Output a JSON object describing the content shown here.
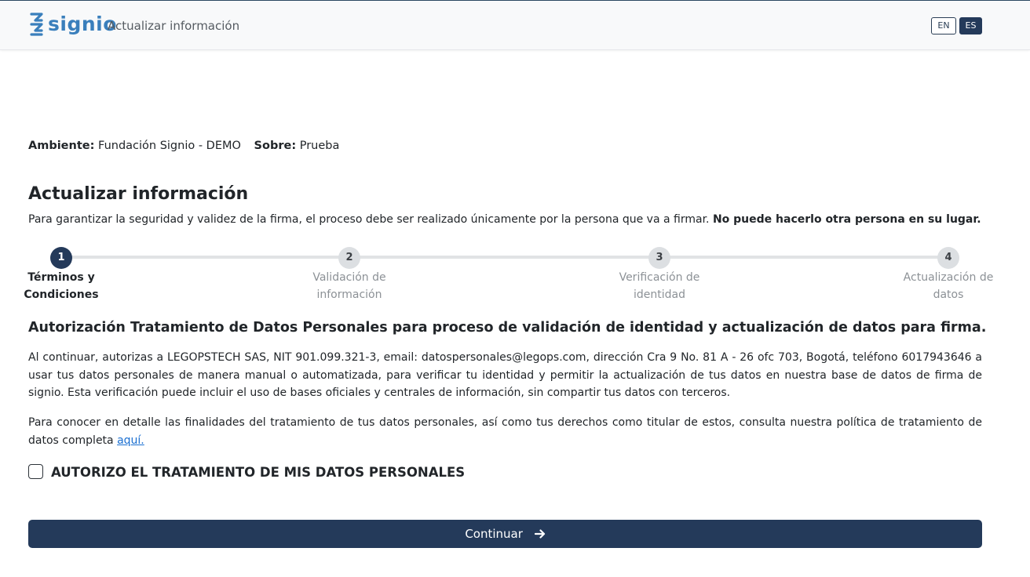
{
  "header": {
    "brand": "signio",
    "title": "Actualizar información",
    "lang_en": "EN",
    "lang_es": "ES",
    "active_lang": "ES",
    "brand_color": "#3a7fbc"
  },
  "env": {
    "ambiente_label": "Ambiente:",
    "ambiente_value": "Fundación Signio - DEMO",
    "sobre_label": "Sobre:",
    "sobre_value": "Prueba"
  },
  "page": {
    "title": "Actualizar información",
    "intro_text": "Para garantizar la seguridad y validez de la firma, el proceso debe ser realizado únicamente por la persona que va a firmar.",
    "intro_bold": "No puede hacerlo otra persona en su lugar."
  },
  "stepper": {
    "current_step": 1,
    "steps": [
      {
        "number": "1",
        "line1": "Términos y",
        "line2": "Condiciones"
      },
      {
        "number": "2",
        "line1": "Validación de",
        "line2": "información"
      },
      {
        "number": "3",
        "line1": "Verificación de",
        "line2": "identidad"
      },
      {
        "number": "4",
        "line1": "Actualización de",
        "line2": "datos"
      }
    ]
  },
  "consent": {
    "title": "Autorización Tratamiento de Datos Personales para proceso de validación de identidad y actualización de datos para firma.",
    "paragraph1": "Al continuar, autorizas a LEGOPSTECH SAS, NIT 901.099.321-3, email: datospersonales@legops.com, dirección Cra 9 No. 81 A - 26 ofc 703, Bogotá, teléfono 6017943646 a usar tus datos personales de manera manual o automatizada, para verificar tu identidad y permitir la actualización de tus datos en nuestra base de datos de firma de signio. Esta verificación puede incluir el uso de bases oficiales y centrales de información, sin compartir tus datos con terceros.",
    "paragraph2": "Para conocer en detalle las finalidades del tratamiento de tus datos personales, así como tus derechos como titular de estos, consulta nuestra política de tratamiento de datos completa",
    "link_text": "aquí.",
    "checkbox_label": "AUTORIZO EL TRATAMIENTO DE MIS DATOS PERSONALES",
    "checkbox_checked": false
  },
  "actions": {
    "continue_label": "Continuar",
    "primary_color": "#243a5a"
  }
}
